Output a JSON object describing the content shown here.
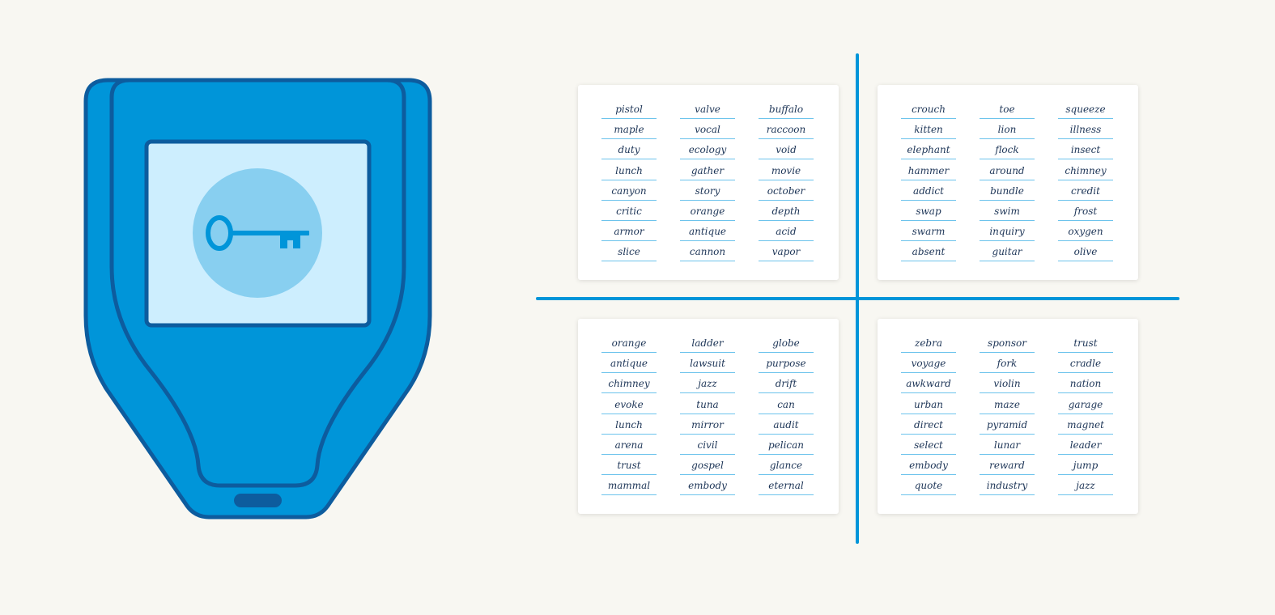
{
  "colors": {
    "background": "#f8f7f2",
    "device_body": "#0095d9",
    "device_outline": "#0d5c9e",
    "screen": "#cdeefe",
    "key_circle": "#88cff0",
    "word_text": "#1d3557",
    "word_underline": "#6cc3ec"
  },
  "device": {
    "screen_icon": "key-icon"
  },
  "cards": [
    {
      "rows": [
        [
          "pistol",
          "valve",
          "buffalo"
        ],
        [
          "maple",
          "vocal",
          "raccoon"
        ],
        [
          "duty",
          "ecology",
          "void"
        ],
        [
          "lunch",
          "gather",
          "movie"
        ],
        [
          "canyon",
          "story",
          "october"
        ],
        [
          "critic",
          "orange",
          "depth"
        ],
        [
          "armor",
          "antique",
          "acid"
        ],
        [
          "slice",
          "cannon",
          "vapor"
        ]
      ]
    },
    {
      "rows": [
        [
          "crouch",
          "toe",
          "squeeze"
        ],
        [
          "kitten",
          "lion",
          "illness"
        ],
        [
          "elephant",
          "flock",
          "insect"
        ],
        [
          "hammer",
          "around",
          "chimney"
        ],
        [
          "addict",
          "bundle",
          "credit"
        ],
        [
          "swap",
          "swim",
          "frost"
        ],
        [
          "swarm",
          "inquiry",
          "oxygen"
        ],
        [
          "absent",
          "guitar",
          "olive"
        ]
      ]
    },
    {
      "rows": [
        [
          "orange",
          "ladder",
          "globe"
        ],
        [
          "antique",
          "lawsuit",
          "purpose"
        ],
        [
          "chimney",
          "jazz",
          "drift"
        ],
        [
          "evoke",
          "tuna",
          "can"
        ],
        [
          "lunch",
          "mirror",
          "audit"
        ],
        [
          "arena",
          "civil",
          "pelican"
        ],
        [
          "trust",
          "gospel",
          "glance"
        ],
        [
          "mammal",
          "embody",
          "eternal"
        ]
      ]
    },
    {
      "rows": [
        [
          "zebra",
          "sponsor",
          "trust"
        ],
        [
          "voyage",
          "fork",
          "cradle"
        ],
        [
          "awkward",
          "violin",
          "nation"
        ],
        [
          "urban",
          "maze",
          "garage"
        ],
        [
          "direct",
          "pyramid",
          "magnet"
        ],
        [
          "select",
          "lunar",
          "leader"
        ],
        [
          "embody",
          "reward",
          "jump"
        ],
        [
          "quote",
          "industry",
          "jazz"
        ]
      ]
    }
  ]
}
